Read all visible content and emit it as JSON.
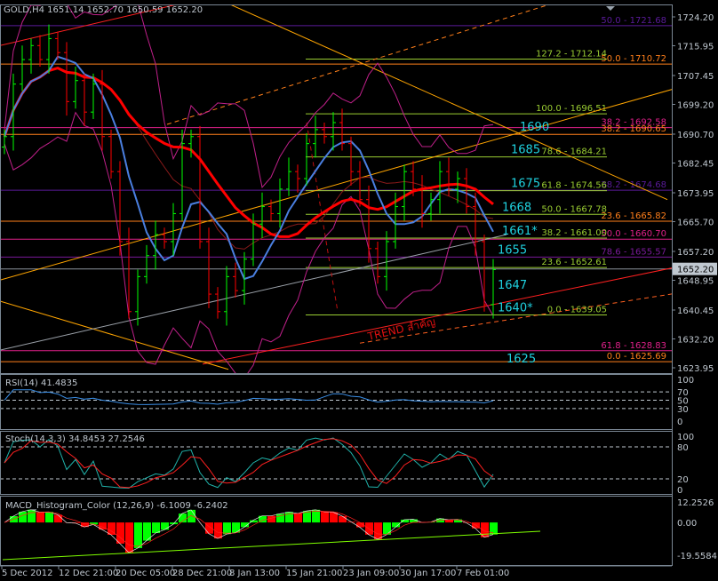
{
  "header": {
    "symbol_line": "GOLD,H4  1651.14 1652.70 1650.59 1652.20",
    "rsi_label": "RSI(14) 41.4835",
    "stoch_label": "Stoch(14,3,3) 34.8453 27.2546",
    "macd_label": "MACD_Histogram_Color (12,26,9)  -6.1009 -6.2402"
  },
  "annotation": {
    "trend_text": "TREND สำคัญ"
  },
  "colors": {
    "background": "#000000",
    "up_bar": "#00ff00",
    "down_bar": "#ff0000",
    "ma_fast": "#4a7fe0",
    "ma_slow": "#ff0000",
    "bands": "#c0208a",
    "grid_border": "#7a8794",
    "fib_left": "#9acd32",
    "pivot_label": "#1fd2e0"
  },
  "chart_data": {
    "type": "candlestick",
    "title": "GOLD,H4",
    "ylim": [
      1623.95,
      1724.2
    ],
    "price_ticks": [
      "1724.20",
      "1715.95",
      "1707.45",
      "1699.20",
      "1690.70",
      "1682.45",
      "1673.95",
      "1665.70",
      "1657.20",
      "1648.95",
      "1640.45",
      "1632.20",
      "1623.95"
    ],
    "current_price": "1652.20",
    "time_ticks": [
      "5 Dec 2012",
      "12 Dec 21:00",
      "20 Dec 05:00",
      "28 Dec 21:00",
      "8 Jan 13:00",
      "15 Jan 21:00",
      "23 Jan 09:00",
      "30 Jan 17:00",
      "7 Feb 01:00"
    ],
    "close": [
      1690,
      1705,
      1712,
      1716,
      1712,
      1718,
      1714,
      1700,
      1706,
      1697,
      1705,
      1690,
      1680,
      1660,
      1640,
      1650,
      1656,
      1662,
      1660,
      1668,
      1688,
      1690,
      1660,
      1645,
      1640,
      1650,
      1646,
      1655,
      1665,
      1670,
      1668,
      1675,
      1680,
      1678,
      1688,
      1692,
      1690,
      1694,
      1688,
      1680,
      1672,
      1658,
      1650,
      1660,
      1670,
      1680,
      1675,
      1668,
      1672,
      1680,
      1675,
      1678,
      1670,
      1660,
      1642,
      1652
    ],
    "fib_levels_left": [
      {
        "label": "127.2 - 1712.14",
        "price": 1712.14
      },
      {
        "label": "100.0 - 1696.51",
        "price": 1696.51
      },
      {
        "label": "78.6 - 1684.21",
        "price": 1684.21
      },
      {
        "label": "61.8 - 1674.56",
        "price": 1674.56
      },
      {
        "label": "50.0 - 1667.78",
        "price": 1667.78
      },
      {
        "label": "38.2 - 1661.00",
        "price": 1661.0
      },
      {
        "label": "23.6 - 1652.61",
        "price": 1652.61
      },
      {
        "label": "0.0 - 1639.05",
        "price": 1639.05
      }
    ],
    "fib_levels_right": [
      {
        "label": "50.0 - 1721.68",
        "price": 1721.68,
        "color": "#5a1a9a"
      },
      {
        "label": "50.0 - 1710.72",
        "price": 1710.72,
        "color": "#ff7f1a"
      },
      {
        "label": "38.2 - 1692.58",
        "price": 1692.58,
        "color": "#e0208a"
      },
      {
        "label": "38.2 - 1690.65",
        "price": 1690.65,
        "color": "#ff7f1a"
      },
      {
        "label": "38.2 - 1674.68",
        "price": 1674.68,
        "color": "#5a1a9a"
      },
      {
        "label": "23.6 - 1665.82",
        "price": 1665.82,
        "color": "#ff7f1a"
      },
      {
        "label": "50.0 - 1660.70",
        "price": 1660.7,
        "color": "#e0208a"
      },
      {
        "label": "78.6 - 1655.57",
        "price": 1655.57,
        "color": "#7a1a9a"
      },
      {
        "label": "61.8 - 1628.83",
        "price": 1628.83,
        "color": "#e0208a"
      },
      {
        "label": "0.0 - 1625.69",
        "price": 1625.69,
        "color": "#ff7f1a"
      }
    ],
    "pivot_labels": [
      {
        "text": "1690",
        "price": 1690.65,
        "bar": 59
      },
      {
        "text": "1685",
        "price": 1684.21,
        "bar": 58
      },
      {
        "text": "1675",
        "price": 1674.56,
        "bar": 58
      },
      {
        "text": "1668",
        "price": 1667.78,
        "bar": 57
      },
      {
        "text": "1661*",
        "price": 1661.0,
        "bar": 57
      },
      {
        "text": "1655",
        "price": 1655.57,
        "bar": 56.5
      },
      {
        "text": "1647",
        "price": 1645.5,
        "bar": 56.5
      },
      {
        "text": "1640*",
        "price": 1639.05,
        "bar": 56.5
      },
      {
        "text": "1625",
        "price": 1624.5,
        "bar": 57.5
      }
    ],
    "trendlines": [
      {
        "from": [
          22.3,
          1625
        ],
        "to": [
          80,
          1655
        ],
        "color": "#ff2020",
        "style": "solid"
      },
      {
        "from": [
          40,
          1631
        ],
        "to": [
          80,
          1647
        ],
        "color": "#ff6020",
        "style": "dashed"
      },
      {
        "from": [
          -0.5,
          1649
        ],
        "to": [
          80,
          1707
        ],
        "color": "#ffa500",
        "style": "solid"
      },
      {
        "from": [
          24.3,
          1729
        ],
        "to": [
          74.6,
          1672
        ],
        "color": "#ffa500",
        "style": "solid"
      },
      {
        "from": [
          -0.5,
          1643
        ],
        "to": [
          25.2,
          1623.5
        ],
        "color": "#ffa500",
        "style": "solid"
      },
      {
        "from": [
          18.3,
          1693.5
        ],
        "to": [
          62.9,
          1729
        ],
        "color": "#ff7f1a",
        "style": "dashed"
      },
      {
        "from": [
          -0.5,
          1629
        ],
        "to": [
          56.5,
          1662
        ],
        "color": "#9aa0a8",
        "style": "solid"
      },
      {
        "from": [
          -0.5,
          1716
        ],
        "to": [
          21.5,
          1729
        ],
        "color": "#ff2020",
        "style": "solid"
      },
      {
        "from": [
          34,
          1694
        ],
        "to": [
          37.5,
          1640
        ],
        "color": "#c01010",
        "style": "dashed"
      }
    ],
    "rsi": {
      "levels": [
        70,
        50,
        30
      ],
      "ticks": [
        "100",
        "70",
        "50",
        "30",
        "0"
      ]
    },
    "stoch": {
      "levels": [
        80,
        20
      ],
      "ticks": [
        "100",
        "80",
        "20",
        "0"
      ]
    },
    "macd": {
      "ticks": [
        "12.2526",
        "0.00",
        "-19.5584"
      ],
      "range": [
        -19.5584,
        12.2526
      ]
    }
  }
}
